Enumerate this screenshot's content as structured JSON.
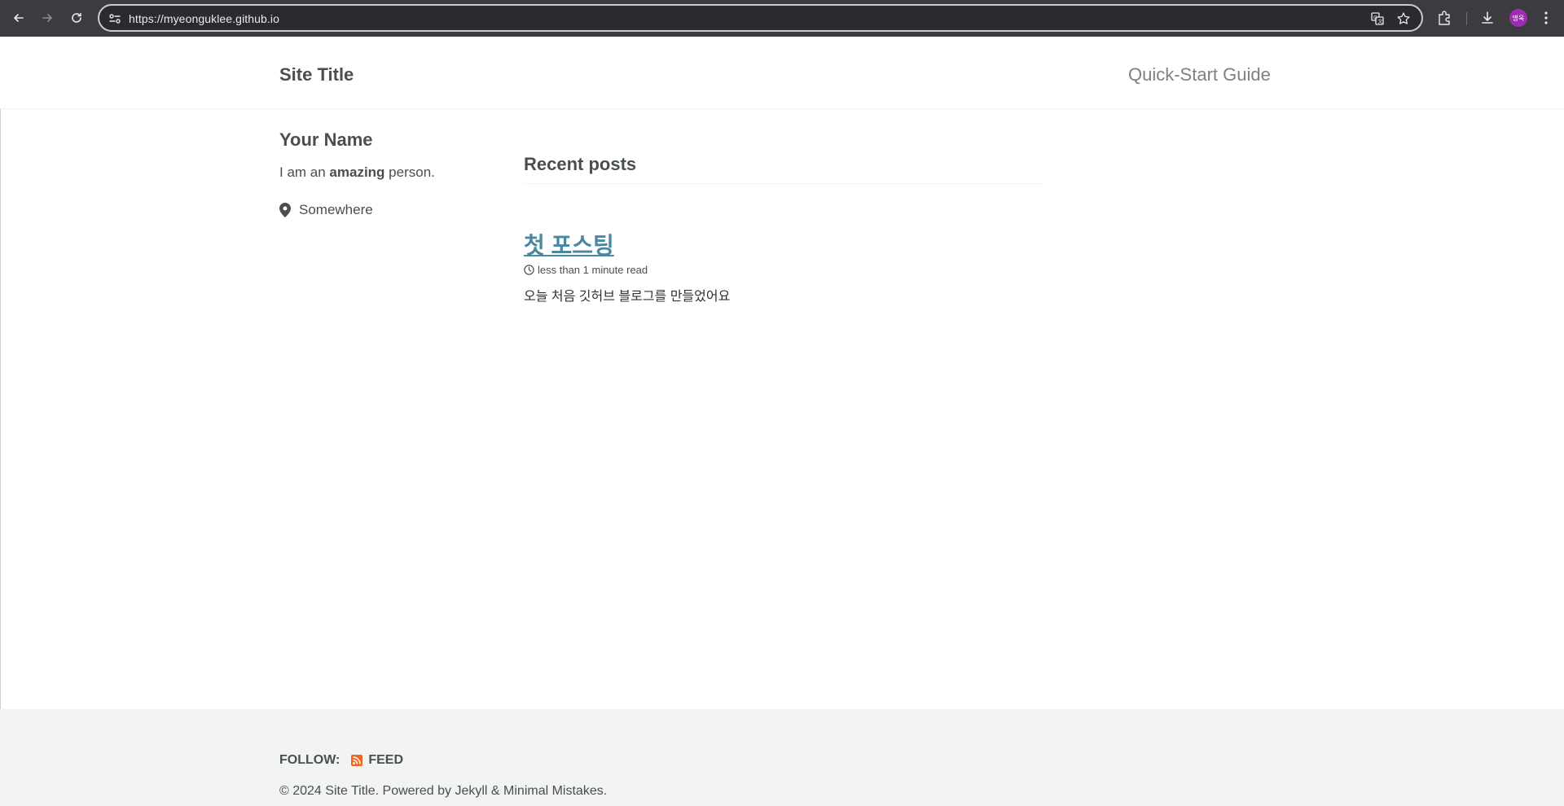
{
  "browser": {
    "url": "https://myeonguklee.github.io",
    "avatar_label": "명욱"
  },
  "masthead": {
    "site_title": "Site Title",
    "nav_links": [
      {
        "label": "Quick-Start Guide"
      }
    ]
  },
  "sidebar": {
    "author_name": "Your Name",
    "bio_prefix": "I am an ",
    "bio_bold": "amazing",
    "bio_suffix": " person.",
    "location": "Somewhere"
  },
  "main": {
    "section_title": "Recent posts",
    "posts": [
      {
        "title": "첫 포스팅",
        "read_time": "less than 1 minute read",
        "excerpt": "오늘 처음 깃허브 블로그를 만들었어요"
      }
    ]
  },
  "footer": {
    "follow_label": "FOLLOW:",
    "feed_label": "FEED",
    "copyright": "© 2024 Site Title. Powered by Jekyll & Minimal Mistakes."
  },
  "colors": {
    "link": "#4a87a0",
    "text": "#494e52",
    "footer_bg": "#f2f3f3",
    "feed_icon": "#f26522"
  },
  "icons": [
    "back-icon",
    "forward-icon",
    "reload-icon",
    "site-info-icon",
    "translate-icon",
    "star-icon",
    "extensions-icon",
    "download-icon",
    "more-icon",
    "map-marker-icon",
    "clock-icon",
    "rss-icon"
  ]
}
